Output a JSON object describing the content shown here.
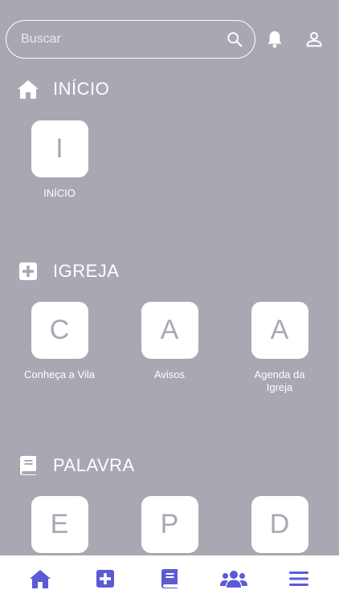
{
  "search": {
    "placeholder": "Buscar"
  },
  "colors": {
    "background": "#a8a8b3",
    "accent": "#5b5bd6",
    "tile": "#ffffff"
  },
  "sections": [
    {
      "title": "INÍCIO",
      "icon": "home-icon",
      "tiles": [
        {
          "letter": "I",
          "label": "INÍCIO"
        }
      ]
    },
    {
      "title": "IGREJA",
      "icon": "plus-square-icon",
      "tiles": [
        {
          "letter": "C",
          "label": "Conheça a Vila"
        },
        {
          "letter": "A",
          "label": "Avisos"
        },
        {
          "letter": "A",
          "label": "Agenda da Igreja"
        }
      ]
    },
    {
      "title": "PALAVRA",
      "icon": "book-icon",
      "tiles": [
        {
          "letter": "E",
          "label": ""
        },
        {
          "letter": "P",
          "label": ""
        },
        {
          "letter": "D",
          "label": ""
        }
      ]
    }
  ],
  "bottom_nav": [
    "home-icon",
    "plus-square-icon",
    "book-icon",
    "users-icon",
    "menu-icon"
  ]
}
